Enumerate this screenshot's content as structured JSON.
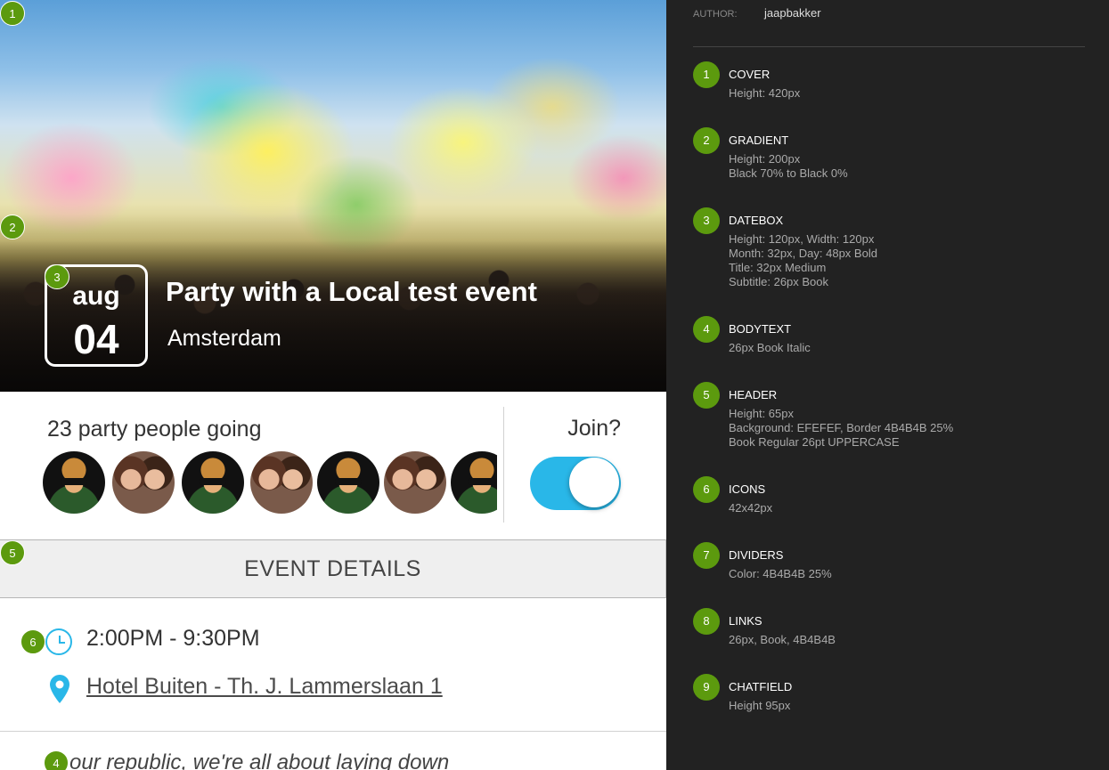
{
  "event": {
    "month": "aug",
    "day": "04",
    "title": "Party with a Local test event",
    "subtitle": "Amsterdam"
  },
  "attendance": {
    "label": "23 party people going",
    "join_label": "Join?",
    "join_on": true,
    "accent_color": "#29b7e8"
  },
  "details": {
    "header": "EVENT DETAILS",
    "time": "2:00PM - 9:30PM",
    "location": "Hotel Buiten - Th. J. Lammerslaan 1"
  },
  "body": {
    "text": "our republic, we're all about laying down"
  },
  "badges": [
    "1",
    "2",
    "3",
    "4",
    "5",
    "6"
  ],
  "spec": {
    "author_label": "AUTHOR:",
    "author": "jaapbakker",
    "badge_color": "#5c9a0e",
    "items": [
      {
        "num": "1",
        "title": "COVER",
        "lines": [
          "Height: 420px"
        ]
      },
      {
        "num": "2",
        "title": "GRADIENT",
        "lines": [
          "Height: 200px",
          "Black 70% to Black 0%"
        ]
      },
      {
        "num": "3",
        "title": "DATEBOX",
        "lines": [
          "Height: 120px, Width: 120px",
          "Month: 32px, Day: 48px Bold",
          "Title: 32px Medium",
          "Subtitle: 26px Book"
        ]
      },
      {
        "num": "4",
        "title": "BODYTEXT",
        "lines": [
          "26px Book Italic"
        ]
      },
      {
        "num": "5",
        "title": "HEADER",
        "lines": [
          "Height: 65px",
          "Background: EFEFEF, Border  4B4B4B 25%",
          "Book Regular 26pt UPPERCASE"
        ]
      },
      {
        "num": "6",
        "title": "ICONS",
        "lines": [
          "42x42px"
        ]
      },
      {
        "num": "7",
        "title": "DIVIDERS",
        "lines": [
          "Color: 4B4B4B 25%"
        ]
      },
      {
        "num": "8",
        "title": "LINKS",
        "lines": [
          "26px, Book, 4B4B4B"
        ]
      },
      {
        "num": "9",
        "title": "CHATFIELD",
        "lines": [
          "Height 95px"
        ]
      }
    ]
  }
}
